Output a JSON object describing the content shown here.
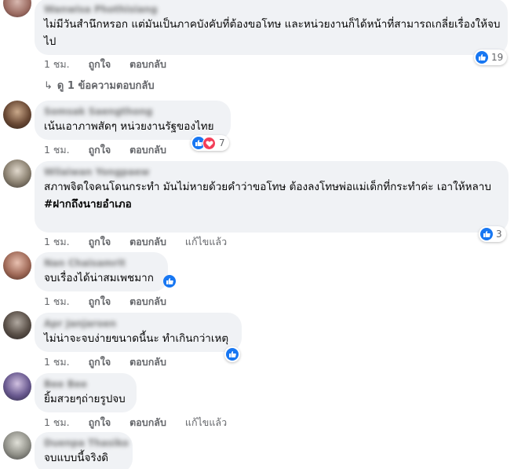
{
  "comments": [
    {
      "author": "Wanwisa Phothisiang",
      "text": "ไม่มีวันสำนึกหรอก แต่มันเป็นภาคบังคับที่ต้องขอโทษ และหน่วยงานก็ได้หน้าที่สามารถเกลี่ยเรื่องให้จบไป",
      "time": "1 ชม.",
      "like_label": "ถูกใจ",
      "reply_label": "ตอบกลับ",
      "reaction_count": "19",
      "view_replies": "ดู 1 ข้อความตอบกลับ"
    },
    {
      "author": "Somsak Saengthong",
      "text": "เน้นเอาภาพสัดๆ หน่วยงานรัฐของไทย",
      "time": "1 ชม.",
      "like_label": "ถูกใจ",
      "reply_label": "ตอบกลับ",
      "reaction_count": "7"
    },
    {
      "author": "Wilaiwan Yongpaew",
      "text": "สภาพจิตใจคนโดนกระทำ มันไม่หายด้วยคำว่าขอโทษ ต้องลงโทษพ่อแม่เด็กที่กระทำค่ะ เอาให้หลาบ",
      "hashtag": "#ฝากถึงนายอำเภอ",
      "time": "1 ชม.",
      "like_label": "ถูกใจ",
      "reply_label": "ตอบกลับ",
      "edited_label": "แก้ไขแล้ว",
      "reaction_count": "3"
    },
    {
      "author": "Nan Chaisamrit",
      "text": "จบเรื่องได้น่าสมเพชมาก",
      "time": "1 ชม.",
      "like_label": "ถูกใจ",
      "reply_label": "ตอบกลับ"
    },
    {
      "author": "Apr Janjaroen",
      "text": "ไม่น่าจะจบง่ายขนาดนี้นะ ทำเกินกว่าเหตุ",
      "time": "1 ชม.",
      "like_label": "ถูกใจ",
      "reply_label": "ตอบกลับ"
    },
    {
      "author": "Bee Bee",
      "text": "ยิ้มสวยๆถ่ายรูปจบ",
      "time": "1 ชม.",
      "like_label": "ถูกใจ",
      "reply_label": "ตอบกลับ",
      "edited_label": "แก้ไขแล้ว"
    },
    {
      "author": "Duenpa Thasiko",
      "text": "จบแบบนี้จริงดิ"
    }
  ],
  "colors": {
    "bubble": "#f0f2f5",
    "meta": "#65676b",
    "like": "#1877f2",
    "love": "#f33e58"
  },
  "icons": {
    "like": "thumbs-up-icon",
    "love": "heart-icon",
    "reply_arrow": "reply-arrow-icon"
  }
}
